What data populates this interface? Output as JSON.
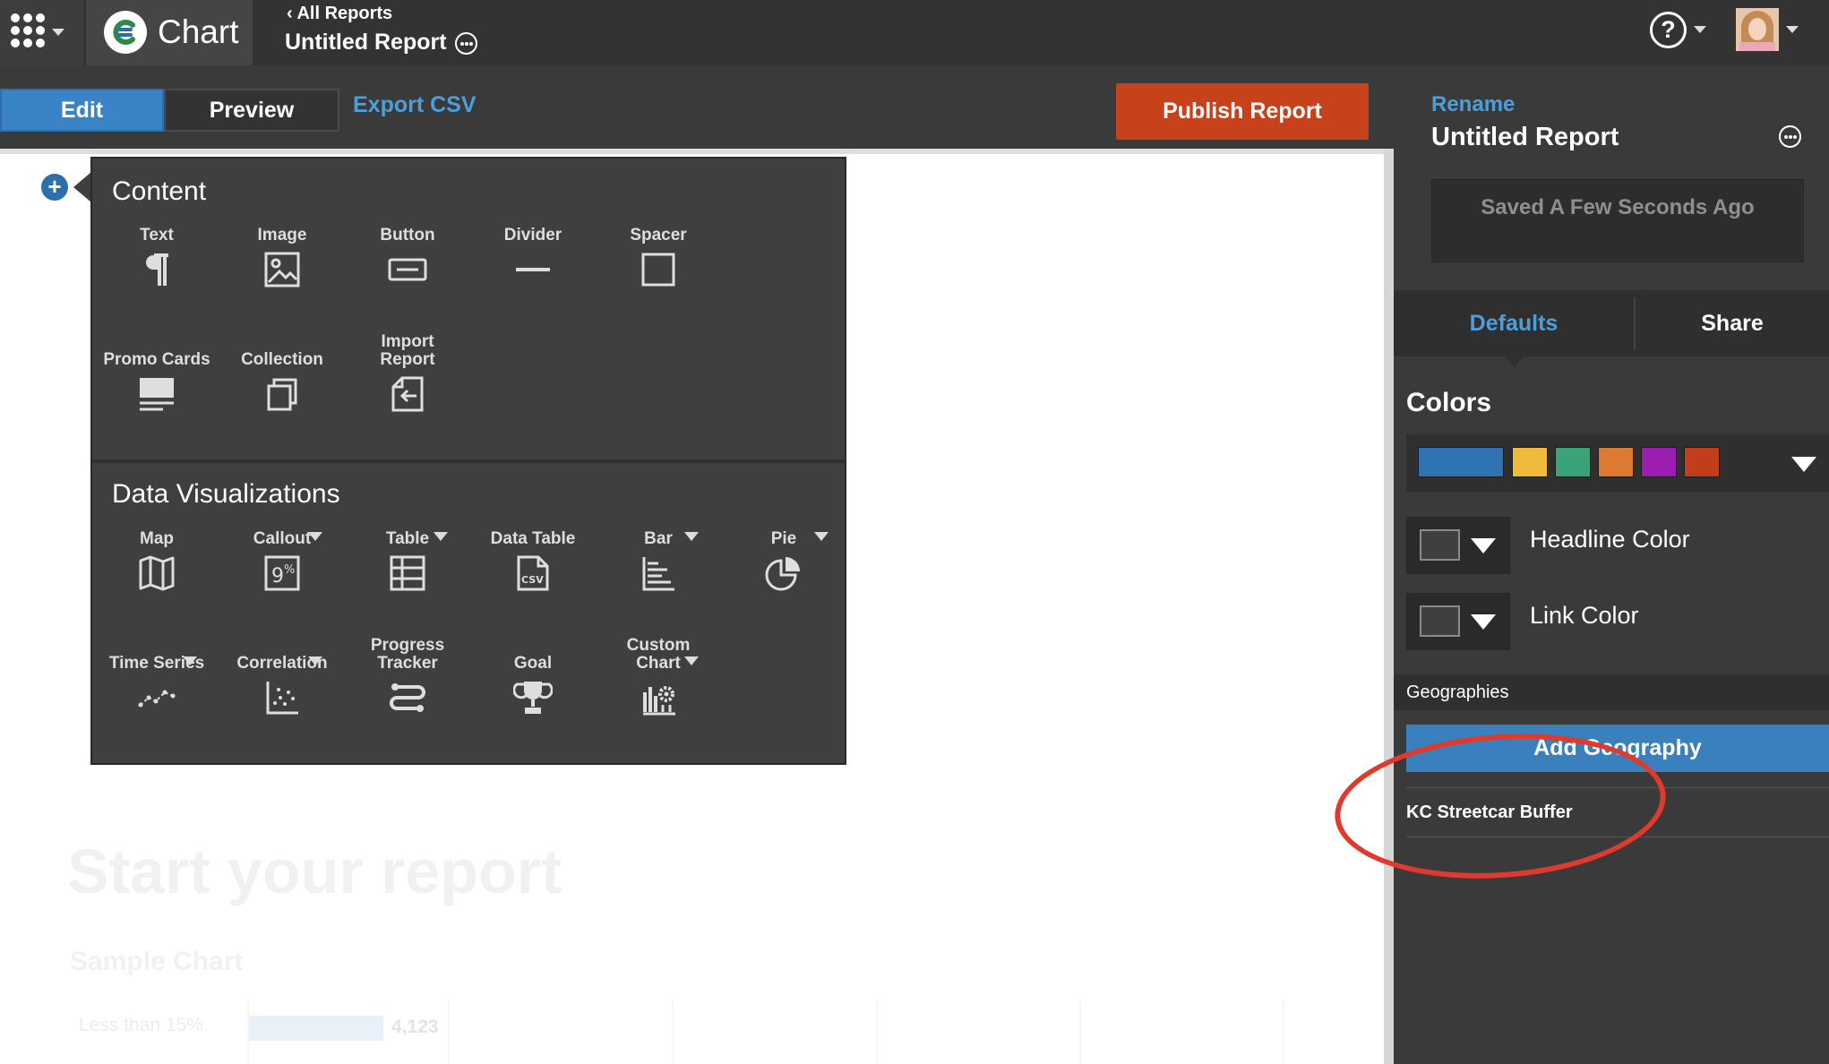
{
  "app": {
    "brand_name": "Chart",
    "breadcrumb_back": "All Reports",
    "report_title": "Untitled Report",
    "help_glyph": "?"
  },
  "toolbar": {
    "edit_label": "Edit",
    "preview_label": "Preview",
    "export_label": "Export CSV",
    "publish_label": "Publish Report"
  },
  "canvas": {
    "add_glyph": "+",
    "ghost_title": "Start your report",
    "ghost_subtitle": "Sample Chart",
    "ghost_row_label": "Less than 15%",
    "ghost_row_value": "4,123"
  },
  "popover": {
    "content_heading": "Content",
    "dataviz_heading": "Data Visualizations",
    "content_items": [
      {
        "label": "Text",
        "icon": "paragraph-icon"
      },
      {
        "label": "Image",
        "icon": "image-icon"
      },
      {
        "label": "Button",
        "icon": "button-icon"
      },
      {
        "label": "Divider",
        "icon": "divider-icon"
      },
      {
        "label": "Spacer",
        "icon": "spacer-icon"
      },
      {
        "label": "Promo Cards",
        "icon": "promo-cards-icon"
      },
      {
        "label": "Collection",
        "icon": "collection-icon"
      },
      {
        "label": "Import Report",
        "icon": "import-report-icon"
      }
    ],
    "viz_items": [
      {
        "label": "Map",
        "icon": "map-icon"
      },
      {
        "label": "Callout",
        "icon": "callout-percent-icon"
      },
      {
        "label": "Table",
        "icon": "table-icon"
      },
      {
        "label": "Data Table",
        "icon": "csv-file-icon"
      },
      {
        "label": "Bar",
        "icon": "bar-chart-icon"
      },
      {
        "label": "Pie",
        "icon": "pie-chart-icon"
      },
      {
        "label": "Time Series",
        "icon": "time-series-icon"
      },
      {
        "label": "Correlation",
        "icon": "scatter-icon"
      },
      {
        "label": "Progress Tracker",
        "icon": "progress-tracker-icon"
      },
      {
        "label": "Goal",
        "icon": "trophy-icon"
      },
      {
        "label": "Custom Chart",
        "icon": "custom-chart-icon"
      }
    ]
  },
  "panel": {
    "rename_label": "Rename",
    "title": "Untitled Report",
    "saved_status": "Saved A Few Seconds Ago",
    "tab_defaults": "Defaults",
    "tab_share": "Share",
    "colors_heading": "Colors",
    "palette": [
      "#2f73b0",
      "#f0bb3c",
      "#3aa379",
      "#dc7a32",
      "#9c1eb0",
      "#c23d1c"
    ],
    "headline_color_label": "Headline Color",
    "link_color_label": "Link Color",
    "geographies_heading": "Geographies",
    "add_geography_label": "Add Geography",
    "geography_item": "KC Streetcar Buffer"
  },
  "colors": {
    "accent_blue": "#4a9fdc",
    "publish_red": "#c7411b",
    "annotation_red": "#e03a2c"
  }
}
